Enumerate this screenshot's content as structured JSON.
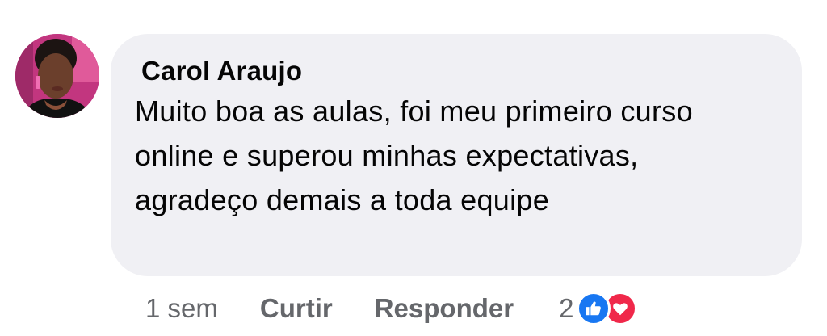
{
  "comment": {
    "author": "Carol Araujo",
    "text": "Muito boa as aulas, foi meu primeiro curso online e superou minhas expectativas, agradeço demais a toda equipe"
  },
  "actions": {
    "time": "1 sem",
    "like_label": "Curtir",
    "reply_label": "Responder"
  },
  "reactions": {
    "count": "2",
    "icons": [
      "like-icon",
      "love-icon"
    ],
    "like_color": "#1877f2",
    "love_color": "#f0284a"
  },
  "colors": {
    "bubble": "#f0f0f4",
    "text": "#050505",
    "secondary_text": "#65676b"
  }
}
